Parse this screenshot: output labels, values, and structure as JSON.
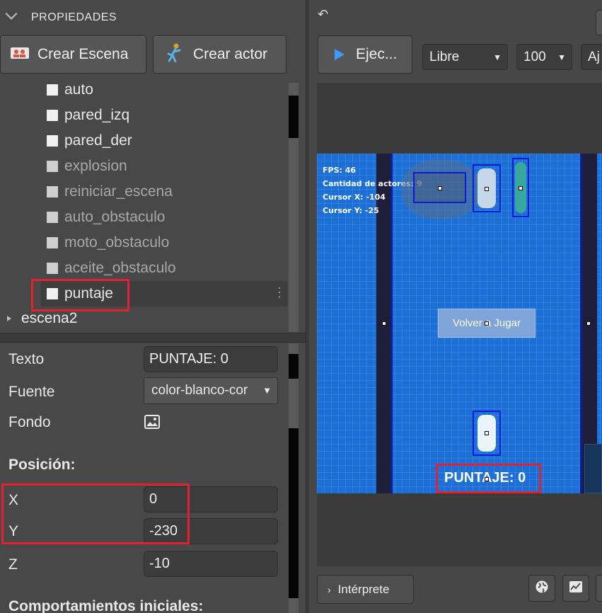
{
  "properties": {
    "header": "PROPIEDADES",
    "create_scene": "Crear Escena",
    "create_actor": "Crear actor"
  },
  "tree": {
    "items": [
      {
        "label": "auto",
        "active": true
      },
      {
        "label": "pared_izq",
        "active": true
      },
      {
        "label": "pared_der",
        "active": true
      },
      {
        "label": "explosion",
        "active": false
      },
      {
        "label": "reiniciar_escena",
        "active": false
      },
      {
        "label": "auto_obstaculo",
        "active": false
      },
      {
        "label": "moto_obstaculo",
        "active": false
      },
      {
        "label": "aceite_obstaculo",
        "active": false
      },
      {
        "label": "puntaje",
        "active": true
      }
    ],
    "scene2": "escena2",
    "more": "⋮"
  },
  "form": {
    "texto_label": "Texto",
    "texto_value": "PUNTAJE: 0",
    "fuente_label": "Fuente",
    "fuente_value": "color-blanco-cor",
    "fondo_label": "Fondo",
    "posicion_title": "Posición:",
    "x_label": "X",
    "x_value": "0",
    "y_label": "Y",
    "y_value": "-230",
    "z_label": "Z",
    "z_value": "-10",
    "behaviors_title": "Comportamientos iniciales:"
  },
  "toolbar": {
    "run": "Ejec...",
    "mode": "Libre",
    "zoom": "100",
    "fit": "Aj"
  },
  "game": {
    "fps": "FPS: 46",
    "actors": "Cantidad de actores: 9",
    "cursor_x": "Cursor X: -104",
    "cursor_y": "Cursor Y: -25",
    "restart": "Volver a Jugar",
    "score": "PUNTAJE: 0"
  },
  "bottom": {
    "interp": "Intérprete"
  },
  "colors": {
    "highlight": "#e32130",
    "play": "#3b9bff",
    "canvas": "#1c6fd6"
  }
}
